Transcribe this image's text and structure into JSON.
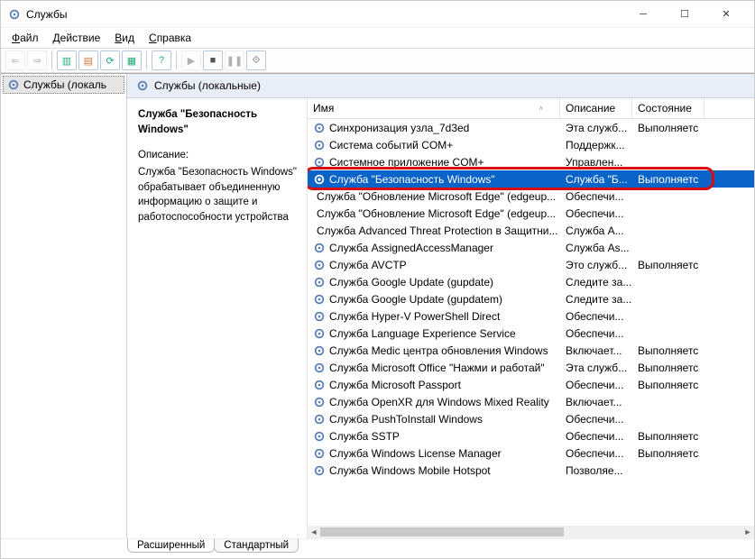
{
  "window": {
    "title": "Службы"
  },
  "menubar": [
    "Файл",
    "Действие",
    "Вид",
    "Справка"
  ],
  "tree": {
    "root_label": "Службы (локаль"
  },
  "pane": {
    "header": "Службы (локальные)"
  },
  "detail": {
    "selected_name": "Служба \"Безопасность Windows\"",
    "desc_label": "Описание:",
    "desc_text": "Служба \"Безопасность Windows\" обрабатывает объединенную информацию о защите и работоспособности устройства"
  },
  "columns": {
    "name": "Имя",
    "desc": "Описание",
    "state": "Состояние"
  },
  "rows": [
    {
      "name": "Синхронизация узла_7d3ed",
      "desc": "Эта служб...",
      "state": "Выполняетс"
    },
    {
      "name": "Система событий COM+",
      "desc": "Поддержк...",
      "state": ""
    },
    {
      "name": "Системное приложение COM+",
      "desc": "Управлен...",
      "state": ""
    },
    {
      "name": "Служба \"Безопасность Windows\"",
      "desc": "Служба \"Б...",
      "state": "Выполняетс",
      "selected": true
    },
    {
      "name": "Служба \"Обновление Microsoft Edge\" (edgeup...",
      "desc": "Обеспечи...",
      "state": ""
    },
    {
      "name": "Служба \"Обновление Microsoft Edge\" (edgeup...",
      "desc": "Обеспечи...",
      "state": ""
    },
    {
      "name": "Служба Advanced Threat Protection в Защитни...",
      "desc": "Служба A...",
      "state": ""
    },
    {
      "name": "Служба AssignedAccessManager",
      "desc": "Служба As...",
      "state": ""
    },
    {
      "name": "Служба AVCTP",
      "desc": "Это служб...",
      "state": "Выполняетс"
    },
    {
      "name": "Служба Google Update (gupdate)",
      "desc": "Следите за...",
      "state": ""
    },
    {
      "name": "Служба Google Update (gupdatem)",
      "desc": "Следите за...",
      "state": ""
    },
    {
      "name": "Служба Hyper-V PowerShell Direct",
      "desc": "Обеспечи...",
      "state": ""
    },
    {
      "name": "Служба Language Experience Service",
      "desc": "Обеспечи...",
      "state": ""
    },
    {
      "name": "Служба Medic центра обновления Windows",
      "desc": "Включает...",
      "state": "Выполняетс"
    },
    {
      "name": "Служба Microsoft Office \"Нажми и работай\"",
      "desc": "Эта служб...",
      "state": "Выполняетс"
    },
    {
      "name": "Служба Microsoft Passport",
      "desc": "Обеспечи...",
      "state": "Выполняетс"
    },
    {
      "name": "Служба OpenXR для Windows Mixed Reality",
      "desc": "Включает...",
      "state": ""
    },
    {
      "name": "Служба PushToInstall Windows",
      "desc": "Обеспечи...",
      "state": ""
    },
    {
      "name": "Служба SSTP",
      "desc": "Обеспечи...",
      "state": "Выполняетс"
    },
    {
      "name": "Служба Windows License Manager",
      "desc": "Обеспечи...",
      "state": "Выполняетс"
    },
    {
      "name": "Служба Windows Mobile Hotspot",
      "desc": "Позволяе...",
      "state": ""
    }
  ],
  "tabs": {
    "extended": "Расширенный",
    "standard": "Стандартный"
  }
}
